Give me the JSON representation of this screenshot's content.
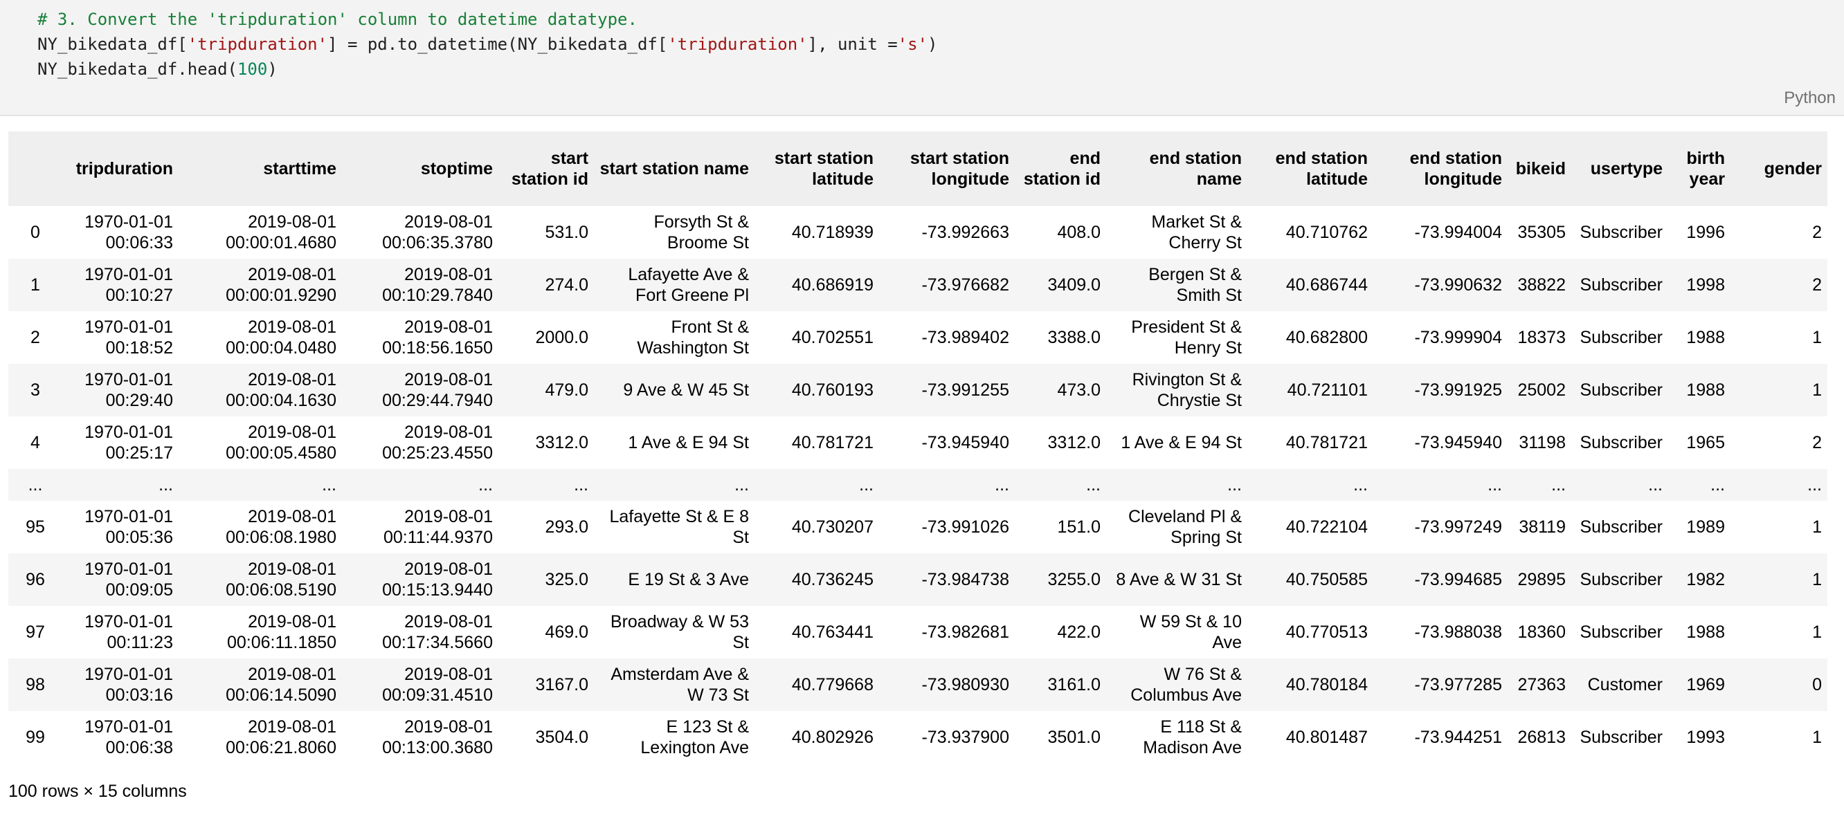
{
  "code": {
    "comment": "# 3. Convert the 'tripduration' column to datetime datatype.",
    "line2": {
      "p1": "NY_bikedata_df[",
      "s1": "'tripduration'",
      "p2": "] = pd.to_datetime(NY_bikedata_df[",
      "s2": "'tripduration'",
      "p3": "], unit =",
      "s3": "'s'",
      "p4": ")"
    },
    "line3": {
      "p1": "NY_bikedata_df.head(",
      "n1": "100",
      "p2": ")"
    },
    "language": "Python"
  },
  "table": {
    "columns": [
      "",
      "tripduration",
      "starttime",
      "stoptime",
      "start station id",
      "start station name",
      "start station latitude",
      "start station longitude",
      "end station id",
      "end station name",
      "end station latitude",
      "end station longitude",
      "bikeid",
      "usertype",
      "birth year",
      "gender"
    ],
    "rows": [
      [
        "0",
        "1970-01-01 00:06:33",
        "2019-08-01 00:00:01.4680",
        "2019-08-01 00:06:35.3780",
        "531.0",
        "Forsyth St & Broome St",
        "40.718939",
        "-73.992663",
        "408.0",
        "Market St & Cherry St",
        "40.710762",
        "-73.994004",
        "35305",
        "Subscriber",
        "1996",
        "2"
      ],
      [
        "1",
        "1970-01-01 00:10:27",
        "2019-08-01 00:00:01.9290",
        "2019-08-01 00:10:29.7840",
        "274.0",
        "Lafayette Ave & Fort Greene Pl",
        "40.686919",
        "-73.976682",
        "3409.0",
        "Bergen St & Smith St",
        "40.686744",
        "-73.990632",
        "38822",
        "Subscriber",
        "1998",
        "2"
      ],
      [
        "2",
        "1970-01-01 00:18:52",
        "2019-08-01 00:00:04.0480",
        "2019-08-01 00:18:56.1650",
        "2000.0",
        "Front St & Washington St",
        "40.702551",
        "-73.989402",
        "3388.0",
        "President St & Henry St",
        "40.682800",
        "-73.999904",
        "18373",
        "Subscriber",
        "1988",
        "1"
      ],
      [
        "3",
        "1970-01-01 00:29:40",
        "2019-08-01 00:00:04.1630",
        "2019-08-01 00:29:44.7940",
        "479.0",
        "9 Ave & W 45 St",
        "40.760193",
        "-73.991255",
        "473.0",
        "Rivington St & Chrystie St",
        "40.721101",
        "-73.991925",
        "25002",
        "Subscriber",
        "1988",
        "1"
      ],
      [
        "4",
        "1970-01-01 00:25:17",
        "2019-08-01 00:00:05.4580",
        "2019-08-01 00:25:23.4550",
        "3312.0",
        "1 Ave & E 94 St",
        "40.781721",
        "-73.945940",
        "3312.0",
        "1 Ave & E 94 St",
        "40.781721",
        "-73.945940",
        "31198",
        "Subscriber",
        "1965",
        "2"
      ],
      [
        "...",
        "...",
        "...",
        "...",
        "...",
        "...",
        "...",
        "...",
        "...",
        "...",
        "...",
        "...",
        "...",
        "...",
        "...",
        "..."
      ],
      [
        "95",
        "1970-01-01 00:05:36",
        "2019-08-01 00:06:08.1980",
        "2019-08-01 00:11:44.9370",
        "293.0",
        "Lafayette St & E 8 St",
        "40.730207",
        "-73.991026",
        "151.0",
        "Cleveland Pl & Spring St",
        "40.722104",
        "-73.997249",
        "38119",
        "Subscriber",
        "1989",
        "1"
      ],
      [
        "96",
        "1970-01-01 00:09:05",
        "2019-08-01 00:06:08.5190",
        "2019-08-01 00:15:13.9440",
        "325.0",
        "E 19 St & 3 Ave",
        "40.736245",
        "-73.984738",
        "3255.0",
        "8 Ave & W 31 St",
        "40.750585",
        "-73.994685",
        "29895",
        "Subscriber",
        "1982",
        "1"
      ],
      [
        "97",
        "1970-01-01 00:11:23",
        "2019-08-01 00:06:11.1850",
        "2019-08-01 00:17:34.5660",
        "469.0",
        "Broadway & W 53 St",
        "40.763441",
        "-73.982681",
        "422.0",
        "W 59 St & 10 Ave",
        "40.770513",
        "-73.988038",
        "18360",
        "Subscriber",
        "1988",
        "1"
      ],
      [
        "98",
        "1970-01-01 00:03:16",
        "2019-08-01 00:06:14.5090",
        "2019-08-01 00:09:31.4510",
        "3167.0",
        "Amsterdam Ave & W 73 St",
        "40.779668",
        "-73.980930",
        "3161.0",
        "W 76 St & Columbus Ave",
        "40.780184",
        "-73.977285",
        "27363",
        "Customer",
        "1969",
        "0"
      ],
      [
        "99",
        "1970-01-01 00:06:38",
        "2019-08-01 00:06:21.8060",
        "2019-08-01 00:13:00.3680",
        "3504.0",
        "E 123 St & Lexington Ave",
        "40.802926",
        "-73.937900",
        "3501.0",
        "E 118 St & Madison Ave",
        "40.801487",
        "-73.944251",
        "26813",
        "Subscriber",
        "1993",
        "1"
      ]
    ],
    "footer": "100 rows × 15 columns"
  }
}
